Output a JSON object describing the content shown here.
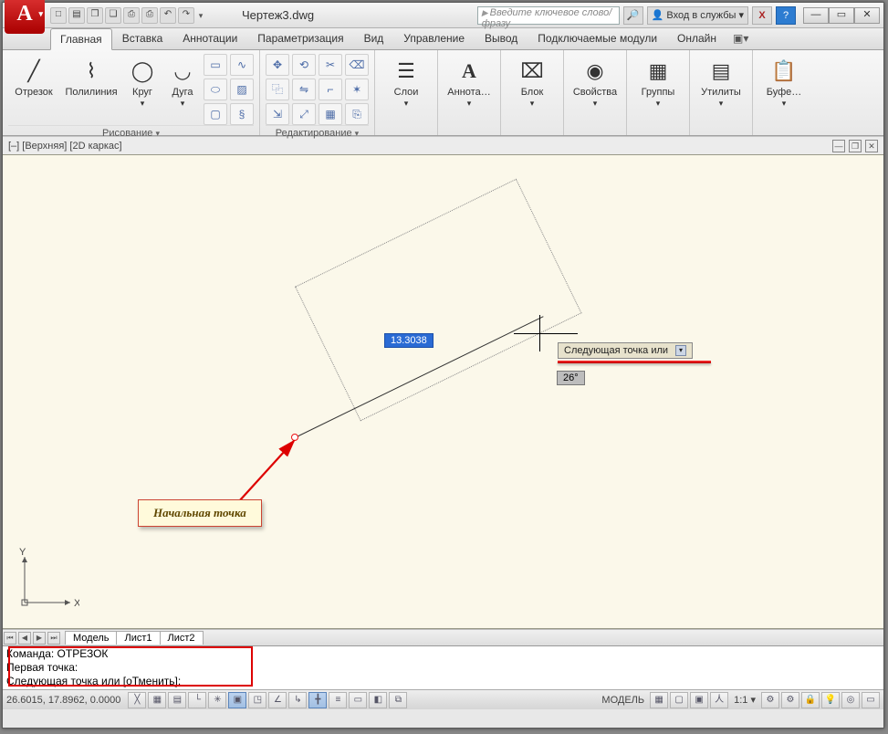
{
  "title": "Чертеж3.dwg",
  "searchPlaceholder": "Введите ключевое слово/фразу",
  "login": {
    "label": "Вход в службы"
  },
  "tabs": [
    "Главная",
    "Вставка",
    "Аннотации",
    "Параметризация",
    "Вид",
    "Управление",
    "Вывод",
    "Подключаемые модули",
    "Онлайн"
  ],
  "activeTab": 0,
  "ribbon": {
    "draw": {
      "title": "Рисование",
      "items": [
        {
          "label": "Отрезок",
          "icon": "╱"
        },
        {
          "label": "Полилиния",
          "icon": "∿"
        },
        {
          "label": "Круг",
          "icon": "◯"
        },
        {
          "label": "Дуга",
          "icon": "◡"
        }
      ],
      "smallIconNames": [
        "rectangle",
        "spline",
        "ellipse",
        "hatch",
        "region",
        "helix",
        "donut"
      ]
    },
    "edit": {
      "title": "Редактирование",
      "smallIconNames": [
        "move",
        "rotate",
        "trim",
        "erase",
        "copy",
        "mirror",
        "fillet",
        "explode",
        "stretch",
        "scale",
        "array",
        "offset",
        "break",
        "join",
        "chamfer",
        "lengthen"
      ]
    },
    "panels": [
      {
        "label": "Слои",
        "icon": "☰",
        "name": "layers"
      },
      {
        "label": "Аннота…",
        "icon": "A",
        "name": "annotation"
      },
      {
        "label": "Блок",
        "icon": "⌧",
        "name": "block"
      },
      {
        "label": "Свойства",
        "icon": "◉",
        "name": "properties"
      },
      {
        "label": "Группы",
        "icon": "▦",
        "name": "groups"
      },
      {
        "label": "Утилиты",
        "icon": "▤",
        "name": "utilities"
      },
      {
        "label": "Буфе…",
        "icon": "📋",
        "name": "clipboard"
      }
    ]
  },
  "viewLabel": "[–] [Верхняя] [2D каркас]",
  "canvas": {
    "distance": "13.3038",
    "angle": "26°",
    "tooltip": "Следующая точка или",
    "annotation": "Начальная точка",
    "ucs": {
      "x": "X",
      "y": "Y"
    }
  },
  "modelTabs": [
    "Модель",
    "Лист1",
    "Лист2"
  ],
  "activeModelTab": 0,
  "command": {
    "line1": "Команда: ОТРЕЗОК",
    "line2": "Первая точка:",
    "prompt": "Следующая точка или [оТменить]:"
  },
  "status": {
    "coords": "26.6015, 17.8962, 0.0000",
    "toggleNames": [
      "infer",
      "snap",
      "grid",
      "ortho",
      "polar",
      "osnap",
      "3dosnap",
      "otrack",
      "ducs",
      "dyn",
      "lwt",
      "tpy",
      "qp",
      "sc"
    ],
    "activeToggles": [
      "osnap",
      "dyn"
    ],
    "right": {
      "space": "МОДЕЛЬ",
      "scale": "1:1"
    }
  }
}
